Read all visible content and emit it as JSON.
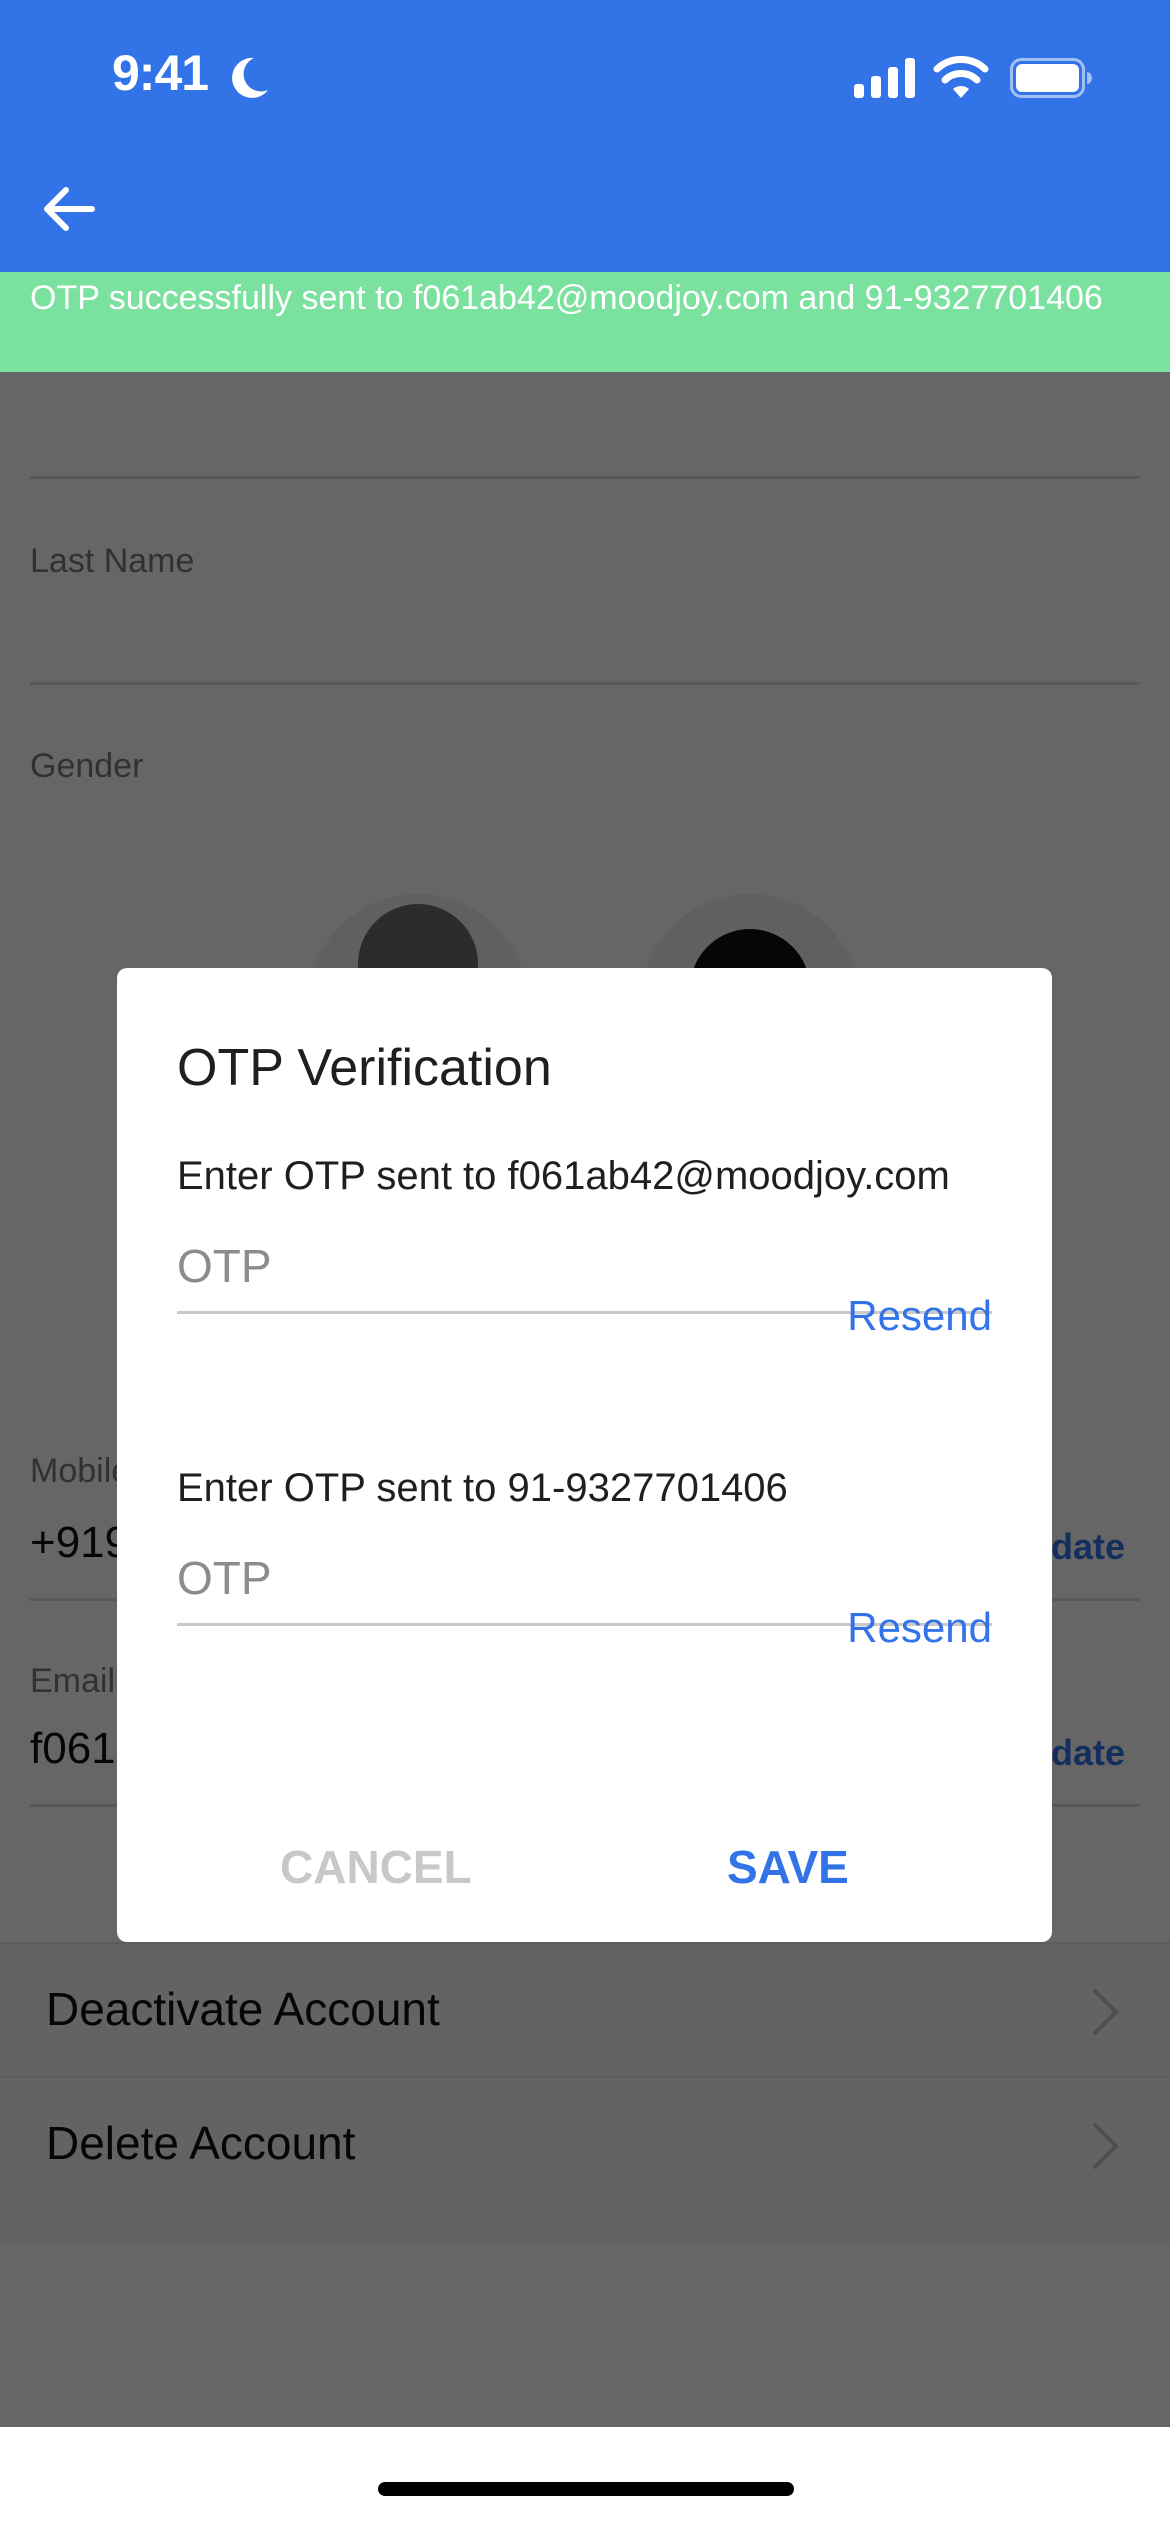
{
  "status_bar": {
    "time": "9:41",
    "focus_icon": "moon-icon",
    "signal_icon": "cellular-signal-icon",
    "wifi_icon": "wifi-icon",
    "battery_icon": "battery-icon"
  },
  "app_bar": {
    "back_icon": "arrow-left-icon",
    "background_color": "#3373e8"
  },
  "toast": {
    "message": "OTP successfully sent to f061ab42@moodjoy.com and 91-9327701406",
    "background_color": "#7ae19e"
  },
  "profile_form": {
    "first_name": {
      "label": "",
      "value": ""
    },
    "last_name": {
      "label": "Last Name",
      "value": ""
    },
    "gender": {
      "label": "Gender",
      "options": [
        "male-avatar",
        "female-avatar"
      ]
    },
    "mobile": {
      "label": "Mobile",
      "value": "+919",
      "action": "Update"
    },
    "email": {
      "label": "Email",
      "value": "f061",
      "action": "Update"
    }
  },
  "account_actions": [
    {
      "label": "Deactivate Account",
      "icon": "chevron-right-icon"
    },
    {
      "label": "Delete Account",
      "icon": "chevron-right-icon"
    }
  ],
  "dialog": {
    "title": "OTP Verification",
    "email_prompt": "Enter OTP sent to f061ab42@moodjoy.com",
    "email_otp": {
      "placeholder": "OTP",
      "value": "",
      "resend_label": "Resend"
    },
    "phone_prompt": "Enter OTP sent to 91-9327701406",
    "phone_otp": {
      "placeholder": "OTP",
      "value": "",
      "resend_label": "Resend"
    },
    "cancel_label": "CANCEL",
    "save_label": "SAVE",
    "accent_color": "#3373e8"
  }
}
